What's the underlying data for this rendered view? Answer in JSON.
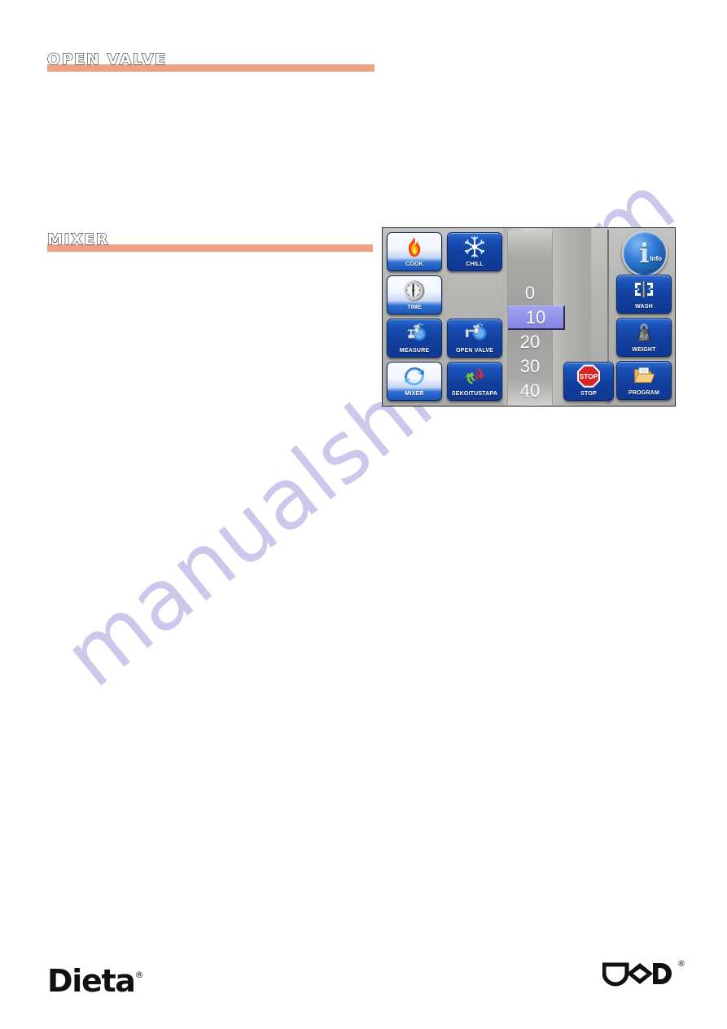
{
  "document": {
    "background_color": "#ffffff",
    "accent_rule_color": "#efa183"
  },
  "watermark": {
    "text": "manualshive.com",
    "color": "#b9b4e4"
  },
  "sections": [
    {
      "id": "open-valve",
      "title": "OPEN VALVE"
    },
    {
      "id": "mixer",
      "title": "MIXER"
    }
  ],
  "control_panel": {
    "left_buttons": [
      {
        "key": "cook",
        "label": "COOK",
        "icon": "flame-icon",
        "style": "light"
      },
      {
        "key": "chill",
        "label": "CHILL",
        "icon": "snowflake-icon",
        "style": "blue"
      },
      {
        "key": "time",
        "label": "TIME",
        "icon": "timer-dial-icon",
        "style": "light"
      },
      {
        "key": "measure",
        "label": "MEASURE",
        "icon": "faucet-icon",
        "style": "blue"
      },
      {
        "key": "open_valve",
        "label": "OPEN VALVE",
        "icon": "faucet-icon",
        "style": "blue"
      },
      {
        "key": "mixer",
        "label": "MIXER",
        "icon": "circular-arrows-icon",
        "style": "light"
      },
      {
        "key": "sekoitustapa",
        "label": "SEKOITUSTAPA",
        "icon": "mix-mode-arrows-icon",
        "style": "blue"
      }
    ],
    "stop_button": {
      "label": "STOP",
      "icon": "stop-sign-icon",
      "badge_text": "STOP",
      "color": "#d82626"
    },
    "info_button": {
      "label": "Info",
      "icon": "info-icon"
    },
    "right_buttons": [
      {
        "key": "wash",
        "label": "WASH",
        "icon": "wash-icon"
      },
      {
        "key": "weight",
        "label": "WEIGHT",
        "icon": "weight-icon"
      },
      {
        "key": "program",
        "label": "PROGRAM",
        "icon": "folder-icon"
      }
    ],
    "number_wheel": {
      "values": [
        "0",
        "10",
        "20",
        "30",
        "40"
      ],
      "selected_value": "10",
      "selected_index": 1,
      "highlight_color": "#9192e8"
    }
  },
  "footer": {
    "left_logo": {
      "name": "Dieta",
      "registered_mark": "®"
    },
    "right_logo": {
      "name": "DOD",
      "registered_mark": "®"
    }
  }
}
